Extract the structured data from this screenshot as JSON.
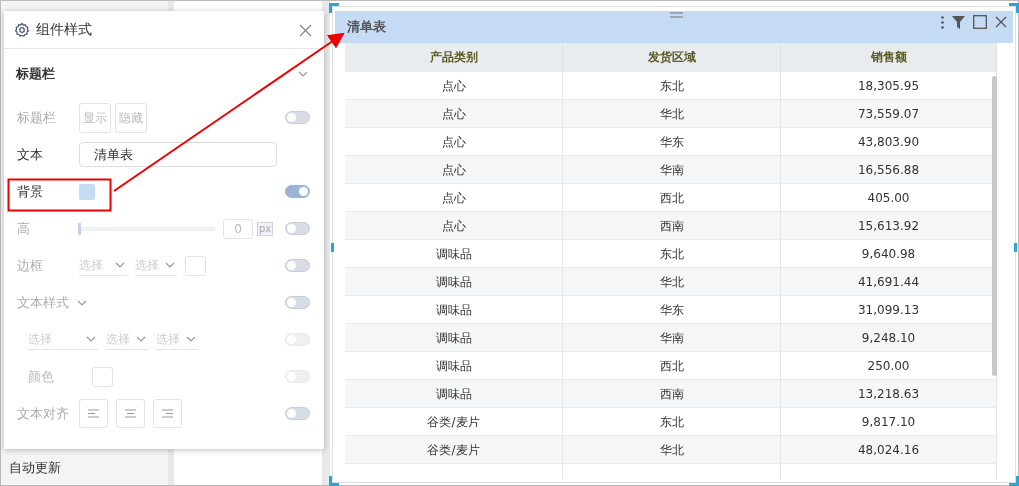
{
  "sidebar": {
    "footer_item": "自动更新"
  },
  "style_panel": {
    "title": "组件样式",
    "section": {
      "title": "标题栏",
      "expanded": true
    },
    "rows": [
      {
        "kind": "buttons",
        "label": "标题栏",
        "disabled": true,
        "options": [
          {
            "label": "显示",
            "selected": false
          },
          {
            "label": "隐藏",
            "selected": false
          }
        ],
        "toggle": {
          "on": false,
          "disabled": false
        }
      },
      {
        "kind": "text",
        "label": "文本",
        "disabled": false,
        "value": "清单表"
      },
      {
        "kind": "color",
        "label": "背景",
        "disabled": false,
        "color": "#c5daf3",
        "toggle": {
          "on": true,
          "disabled": false
        }
      },
      {
        "kind": "slider",
        "label": "高",
        "disabled": true,
        "level": 0,
        "value": "0",
        "unit": "px",
        "toggle": {
          "on": false,
          "disabled": false
        }
      },
      {
        "kind": "selects",
        "label": "边框",
        "disabled": true,
        "selects": [
          {
            "placeholder": "选择"
          },
          {
            "placeholder": "选择"
          }
        ],
        "swatch": true,
        "toggle": {
          "on": false,
          "disabled": false
        }
      },
      {
        "kind": "group",
        "label": "文本样式",
        "disabled": true,
        "expanded": true,
        "toggle": {
          "on": false,
          "disabled": false
        },
        "children": [
          {
            "kind": "selects",
            "disabled": true,
            "selects": [
              {
                "placeholder": "选择"
              },
              {
                "placeholder": "选择"
              },
              {
                "placeholder": "选择"
              }
            ],
            "toggle": {
              "on": false,
              "disabled": true
            }
          },
          {
            "kind": "color",
            "label": "颜色",
            "disabled": true,
            "color": "#ffffff",
            "toggle": {
              "on": false,
              "disabled": true
            }
          }
        ]
      },
      {
        "kind": "align",
        "label": "文本对齐",
        "disabled": true,
        "options": [
          {
            "kind": "left",
            "selected": false
          },
          {
            "kind": "center",
            "selected": false
          },
          {
            "kind": "right",
            "selected": false
          }
        ],
        "toggle": {
          "on": false,
          "disabled": false
        }
      }
    ]
  },
  "widget": {
    "title": "清单表",
    "table": {
      "columns": [
        "产品类别",
        "发货区域",
        "销售额"
      ],
      "rows": [
        [
          "点心",
          "东北",
          "18,305.95"
        ],
        [
          "点心",
          "华北",
          "73,559.07"
        ],
        [
          "点心",
          "华东",
          "43,803.90"
        ],
        [
          "点心",
          "华南",
          "16,556.88"
        ],
        [
          "点心",
          "西北",
          "405.00"
        ],
        [
          "点心",
          "西南",
          "15,613.92"
        ],
        [
          "调味品",
          "东北",
          "9,640.98"
        ],
        [
          "调味品",
          "华北",
          "41,691.44"
        ],
        [
          "调味品",
          "华东",
          "31,099.13"
        ],
        [
          "调味品",
          "华南",
          "9,248.10"
        ],
        [
          "调味品",
          "西北",
          "250.00"
        ],
        [
          "调味品",
          "西南",
          "13,218.63"
        ],
        [
          "谷类/麦片",
          "东北",
          "9,817.10"
        ],
        [
          "谷类/麦片",
          "华北",
          "48,024.16"
        ]
      ]
    }
  }
}
